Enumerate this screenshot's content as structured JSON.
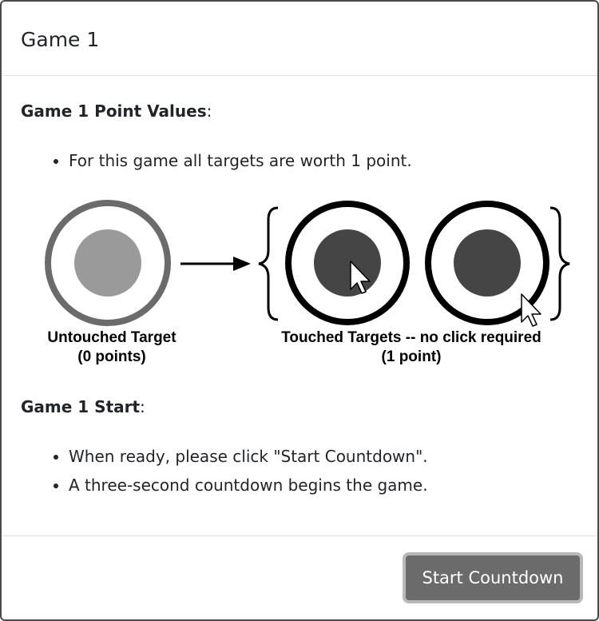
{
  "modal": {
    "title": "Game 1"
  },
  "point_values": {
    "heading_bold": "Game 1 Point Values",
    "heading_suffix": ":",
    "bullets": [
      "For this game all targets are worth 1 point."
    ]
  },
  "diagram": {
    "untouched_label_line1": "Untouched Target",
    "untouched_label_line2": "(0 points)",
    "touched_label_line1": "Touched Targets -- no click required",
    "touched_label_line2": "(1 point)",
    "colors": {
      "untouched_ring": "#6b6b6b",
      "untouched_dot": "#9a9a9a",
      "touched_ring": "#000000",
      "touched_dot": "#454545"
    }
  },
  "start": {
    "heading_bold": "Game 1 Start",
    "heading_suffix": ":",
    "bullets": [
      "When ready, please click \"Start Countdown\".",
      "A three-second countdown begins the game."
    ]
  },
  "footer": {
    "start_button_label": "Start Countdown"
  }
}
